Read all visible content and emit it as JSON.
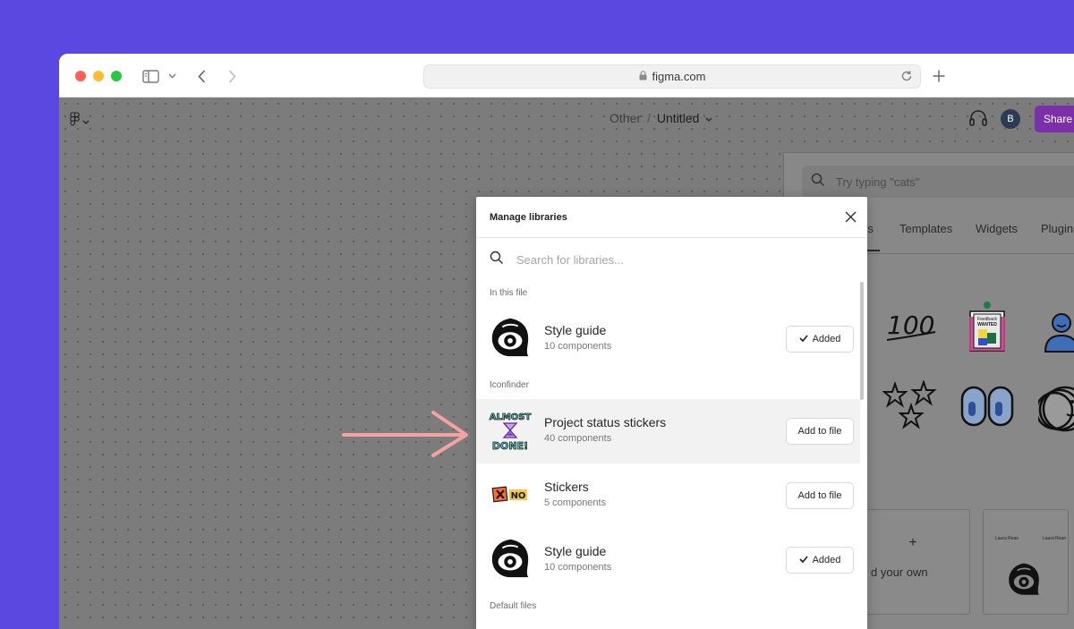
{
  "browser": {
    "url": "figma.com",
    "icons": [
      "sidebar-toggle-icon",
      "chevron-down-icon",
      "back-icon",
      "forward-icon",
      "lock-icon",
      "reload-icon",
      "new-tab-icon"
    ]
  },
  "figma": {
    "breadcrumb_parent": "Other",
    "breadcrumb_separator": "/",
    "file_name": "Untitled",
    "avatar_initial": "B",
    "share_label": "Share"
  },
  "resources": {
    "search_placeholder": "Try typing \"cats\"",
    "tabs": [
      "rs",
      "Templates",
      "Widgets",
      "Plugins"
    ],
    "card_labels": [
      "+",
      "d your own"
    ],
    "card_thumb_text": [
      "Laura Rean",
      "Laura Rean"
    ]
  },
  "modal": {
    "title": "Manage libraries",
    "search_placeholder": "Search for libraries...",
    "sections": {
      "in_this_file": "In this file",
      "iconfinder": "Iconfinder",
      "default_files": "Default files"
    },
    "libraries": [
      {
        "name": "Style guide",
        "count": "10 components",
        "button": "Added",
        "added": true
      },
      {
        "name": "Project status stickers",
        "count": "40 components",
        "button": "Add to file",
        "added": false
      },
      {
        "name": "Stickers",
        "count": "5 components",
        "button": "Add to file",
        "added": false
      },
      {
        "name": "Style guide",
        "count": "10 components",
        "button": "Added",
        "added": true
      }
    ]
  },
  "stickers": {
    "almost_done_line1": "ALMOST",
    "almost_done_line2": "DONE!",
    "no_text": "NO",
    "hundred": "100",
    "feedback_line1": "Feedback",
    "feedback_line2": "WANTED"
  },
  "colors": {
    "background": "#5a48e0",
    "share": "#7b2fa8",
    "annotation_arrow": "#f4a3a0"
  }
}
